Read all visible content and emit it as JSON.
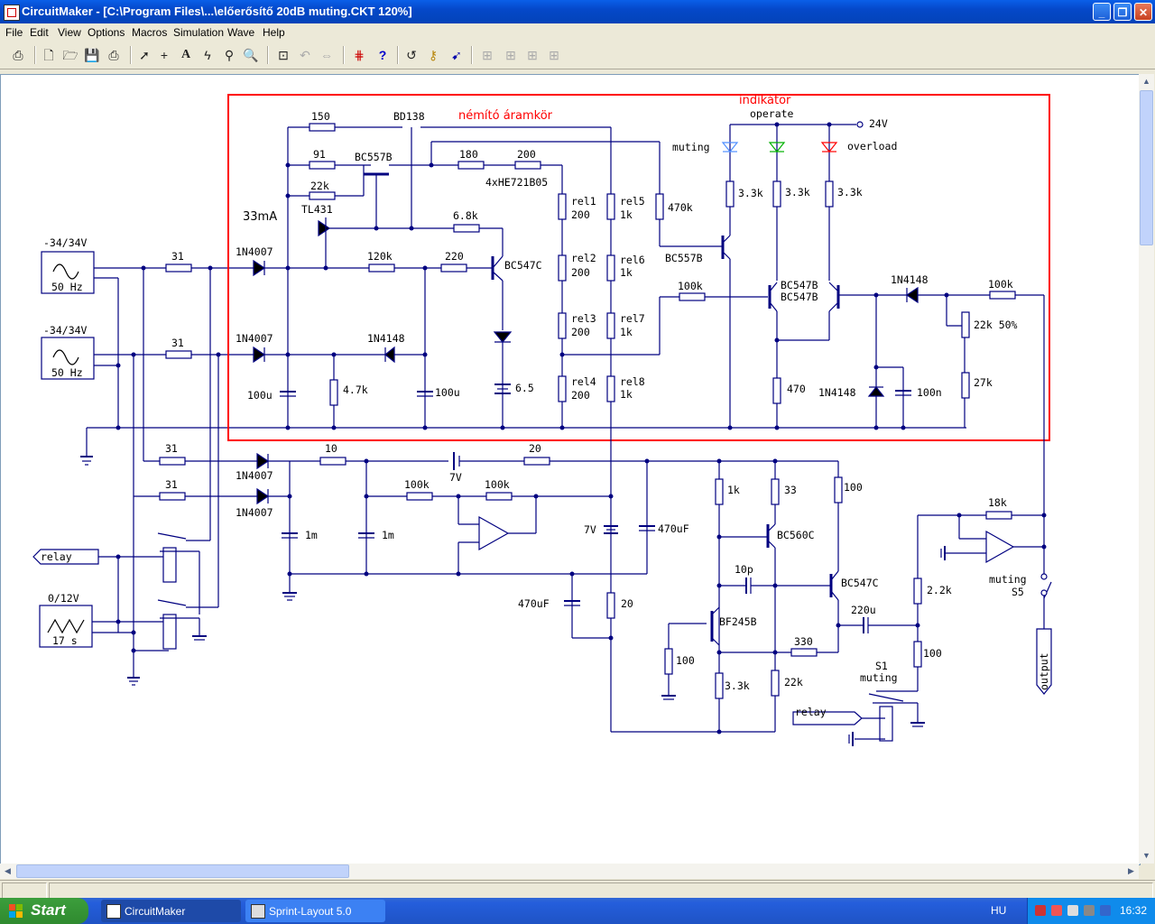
{
  "window": {
    "title": "CircuitMaker - [C:\\Program Files\\...\\előerősítő 20dB muting.CKT 120%]"
  },
  "menu": [
    "File",
    "Edit",
    "View",
    "Options",
    "Macros",
    "Simulation",
    "Wave",
    "Help"
  ],
  "toolbar_icons": [
    "print-setup-icon",
    "new-file-icon",
    "open-folder-icon",
    "save-icon",
    "print-icon",
    "arrow-tool-icon",
    "wire-tool-icon",
    "text-tool-icon",
    "probe-tool-icon",
    "digital-probe-icon",
    "zoom-tool-icon",
    "zoom-fit-icon",
    "rotate-icon",
    "mirror-icon",
    "netlist-icon",
    "help-icon",
    "undo-icon",
    "macro-icon",
    "run-icon",
    "align-icon",
    "align2-icon",
    "align3-icon",
    "align4-icon"
  ],
  "schematic": {
    "sec_muting": "némító áramkör",
    "sec_indicator": "indikátor",
    "operate": "operate",
    "v24": "24V",
    "led_muting": "muting",
    "led_overload": "overload",
    "src1_range": "-34/34V",
    "src1_freq": "50 Hz",
    "src2_range": "-34/34V",
    "src2_freq": "50 Hz",
    "src3_range": "0/12V",
    "src3_time": "17 s",
    "r31a": "31",
    "r31b": "31",
    "r31c": "31",
    "r31d": "31",
    "d1": "1N4007",
    "d2": "1N4007",
    "d3": "1N4007",
    "d4": "1N4007",
    "r150": "150",
    "q_bd138": "BD138",
    "r91": "91",
    "q_bc557b": "BC557B",
    "r22k": "22k",
    "u_tl431": "TL431",
    "i33": "33mA",
    "r180": "180",
    "r200": "200",
    "relay_type": "4xHE721B05",
    "r68k": "6.8k",
    "r120k": "120k",
    "r220": "220",
    "q_bc547c": "BC547C",
    "d_1n4148a": "1N4148",
    "c100u_a": "100u",
    "r47k": "4.7k",
    "c100u_b": "100u",
    "v65": "6.5",
    "rel1": "rel1",
    "rel1v": "200",
    "rel2": "rel2",
    "rel2v": "200",
    "rel3": "rel3",
    "rel3v": "200",
    "rel4": "rel4",
    "rel4v": "200",
    "rel5": "rel5",
    "rel5v": "1k",
    "rel6": "rel6",
    "rel6v": "1k",
    "rel7": "rel7",
    "rel7v": "1k",
    "rel8": "rel8",
    "rel8v": "1k",
    "r470k": "470k",
    "q_bc557b2": "BC557B",
    "r33ka": "3.3k",
    "r33kb": "3.3k",
    "r33kc": "3.3k",
    "r100k_a": "100k",
    "q_bc547b": "BC547B",
    "q_bc547b2": "BC547B",
    "d_1n4148b": "1N4148",
    "r100k_b": "100k",
    "pot": "22k 50%",
    "r470": "470",
    "d_1n4148c": "1N4148",
    "c100n": "100n",
    "r27k": "27k",
    "r10": "10",
    "b7v": "7V",
    "r20": "20",
    "r100k_c": "100k",
    "r100k_d": "100k",
    "c1m_a": "1m",
    "c1m_b": "1m",
    "relay_a": "relay",
    "b7v_b": "7V",
    "c470uf_a": "470uF",
    "c470uf_b": "470uF",
    "r20b": "20",
    "r1k": "1k",
    "r33": "33",
    "r100a": "100",
    "q_bc560c": "BC560C",
    "c10p": "10p",
    "q_bc547c2": "BC547C",
    "q_bf245b": "BF245B",
    "r100b": "100",
    "r33kd": "3.3k",
    "r330": "330",
    "r22kb": "22k",
    "c220u": "220u",
    "r18k": "18k",
    "r22k_out": "2.2k",
    "r100c": "100",
    "sw_muting": "muting",
    "sw_s5": "S5",
    "s1": "S1",
    "s1_muting": "muting",
    "relay_b": "relay",
    "out": "output"
  },
  "taskbar": {
    "start": "Start",
    "tasks": [
      "CircuitMaker",
      "Sprint-Layout 5.0"
    ],
    "lang": "HU",
    "clock": "16:32"
  },
  "colors": {
    "wire": "#000080",
    "box": "#ff0000",
    "title_bar": "#0548C9"
  }
}
